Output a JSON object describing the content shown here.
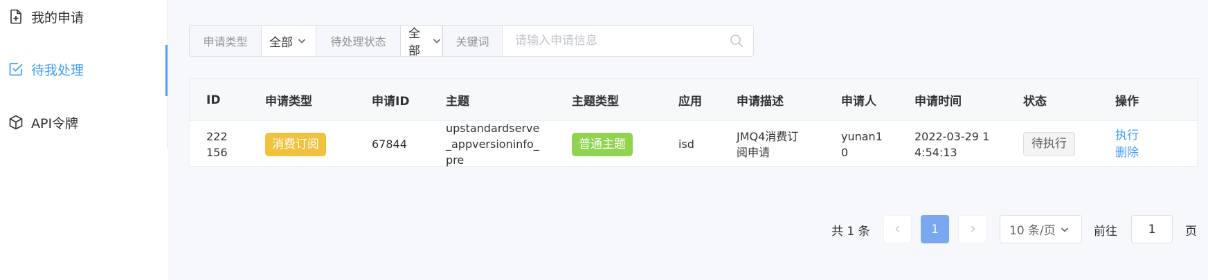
{
  "sidebar": {
    "items": [
      {
        "label": "我的申请",
        "icon": "file-add-icon"
      },
      {
        "label": "待我处理",
        "icon": "checkbox-icon",
        "active": true
      },
      {
        "label": "API令牌",
        "icon": "cube-icon"
      }
    ]
  },
  "filters": {
    "type_label": "申请类型",
    "type_value": "全部",
    "status_label": "待处理状态",
    "status_value": "全部",
    "keyword_label": "关键词",
    "keyword_placeholder": "请输入申请信息",
    "keyword_value": ""
  },
  "table": {
    "headers": [
      "ID",
      "申请类型",
      "申请ID",
      "主题",
      "主题类型",
      "应用",
      "申请描述",
      "申请人",
      "申请时间",
      "状态",
      "操作"
    ],
    "rows": [
      {
        "id": "222156",
        "apply_type": "消费订阅",
        "apply_id": "67844",
        "topic": "upstandardserve_appversioninfo_pre",
        "topic_type": "普通主题",
        "app": "isd",
        "description": "JMQ4消费订阅申请",
        "applicant": "yunan10",
        "apply_time": "2022-03-29 14:54:13",
        "status": "待执行",
        "actions": [
          "执行",
          "删除"
        ]
      }
    ]
  },
  "pagination": {
    "total_text": "共 1 条",
    "current_page": "1",
    "page_size": "10 条/页",
    "goto_label": "前往",
    "goto_value": "1",
    "page_suffix": "页"
  },
  "colors": {
    "accent": "#409eff",
    "apply_type_tag": "#f2c13e",
    "topic_type_tag": "#8fd34e",
    "active_page": "#79a8f0"
  }
}
